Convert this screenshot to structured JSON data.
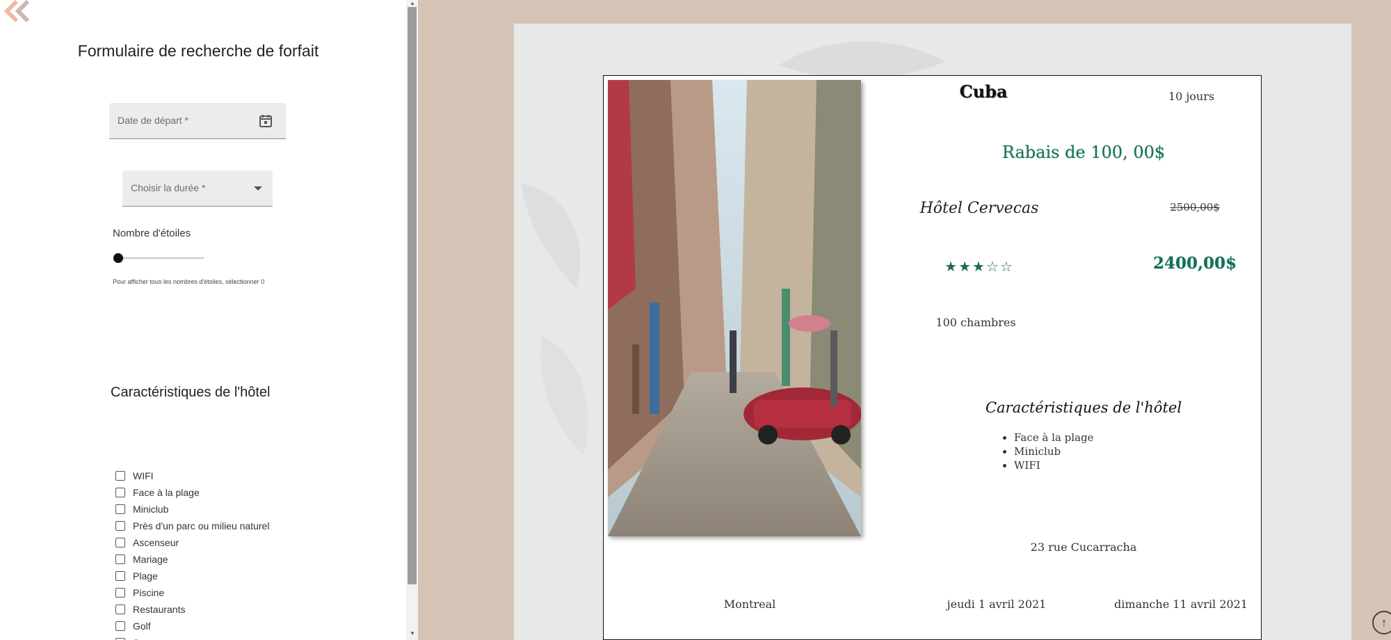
{
  "sidebar": {
    "title": "Formulaire de recherche de forfait",
    "date_placeholder": "Date de départ *",
    "duration_placeholder": "Choisir la durée *",
    "stars_label": "Nombre d'étoiles",
    "stars_value": 0,
    "stars_hint": "Pour afficher tous les nombres d'étoiles, sélectionner 0",
    "features_title": "Caractéristiques de l'hôtel",
    "features": [
      "WIFI",
      "Face à la plage",
      "Miniclub",
      "Près d'un parc ou milieu naturel",
      "Ascenseur",
      "Mariage",
      "Plage",
      "Piscine",
      "Restaurants",
      "Golf",
      "Spa"
    ]
  },
  "card": {
    "destination": "Cuba",
    "duration": "10 jours",
    "discount": "Rabais de 100, 00$",
    "hotel": "Hôtel Cervecas",
    "old_price": "2500,00$",
    "rating": "★★★☆☆",
    "new_price": "2400,00$",
    "rooms": "100 chambres",
    "features_title": "Caractéristiques de l'hôtel",
    "features": [
      "Face à la plage",
      "Miniclub",
      "WIFI"
    ],
    "address": "23 rue Cucarracha",
    "departure_city": "Montreal",
    "departure_date": "jeudi 1 avril 2021",
    "return_date": "dimanche 11 avril 2021"
  },
  "colors": {
    "background": "#d5c3b6",
    "accent_green": "#1a6b57",
    "collapse_icon": "#f0b9a6"
  },
  "icons": [
    "collapse-icon",
    "calendar-icon",
    "dropdown-arrow-icon",
    "scroll-to-top-icon"
  ]
}
